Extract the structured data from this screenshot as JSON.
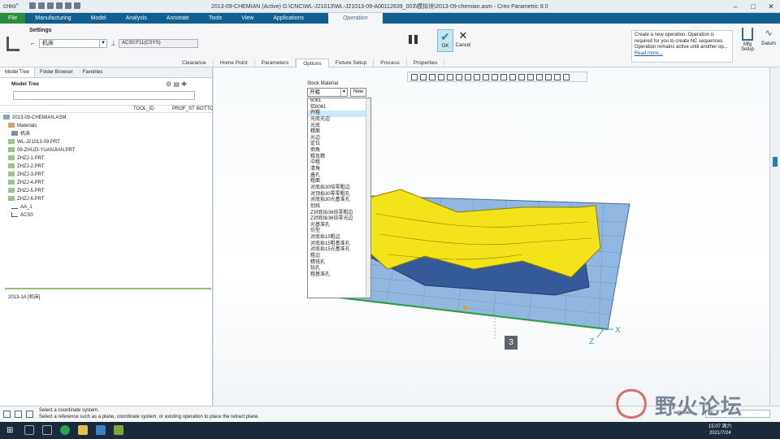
{
  "window": {
    "logo": "creo°",
    "title": "2013-09-CHEMIAN (Active) G:\\CNC\\WL-J21013\\WL-J21013-09-A00112639_003\\模拟块\\2013-09-chemian.asm - Creo Parametric 8.0"
  },
  "ribbon_tabs": [
    "File",
    "Manufacturing",
    "Model",
    "Analysis",
    "Annotate",
    "Tools",
    "View",
    "Applications",
    "Operation"
  ],
  "ribbon": {
    "settings_label": "Settings",
    "machine_value": "机床",
    "csys_value": "ACS0:F11(CSYS)",
    "ok_label": "OK",
    "cancel_label": "Cancel",
    "subtabs": [
      "Clearance",
      "Home Point",
      "Parameters",
      "Options",
      "Fixture Setup",
      "Process",
      "Properties"
    ],
    "message": "Create a new operation. Operation is required for you to create NC sequences. Operation remains active until another op...",
    "read_more": "Read more...",
    "mfg_setup_label": "Mfg Setup",
    "datum_label": "Datum"
  },
  "left_panel": {
    "tabs": [
      "Model Tree",
      "Folder Browser",
      "Favorites"
    ],
    "model_tree_label": "Model Tree",
    "columns": [
      "TOOL_ID",
      "PROF_ST",
      "BOTTC"
    ],
    "tree": [
      "2013-09-CHEMIAN.ASM",
      "Materials",
      "机床",
      "WL-J21013-09.PRT",
      "09-ZHUZI-YUANJIAN.PRT",
      "ZHZJ-1.PRT",
      "ZHZJ-2.PRT",
      "ZHZJ-3.PRT",
      "ZHZJ-4.PRT",
      "ZHZJ-5.PRT",
      "ZHZJ-6.PRT",
      "AA_1",
      "ACS0"
    ],
    "op_node": "2013-1A [机床]"
  },
  "stock_material": {
    "label": "Stock Material",
    "selected": "开粗",
    "new_button": "New",
    "options": [
      "6061",
      "铝6061",
      "开粗",
      "光底光边",
      "光底",
      "精面",
      "光边",
      "定位",
      "倒角",
      "粗及精",
      "中粗",
      "清角",
      "叠孔",
      "粗面",
      "对底抬30倍零粗边",
      "对顶抬30零零粗孔",
      "对底抬30光基准孔",
      "划线",
      "Z对底抬36倍零粗边",
      "Z对底抬36倍零光边",
      "光基准孔",
      "仿型",
      "对底抬15粗边",
      "对底抬15粗基准孔",
      "对底抬15光基准孔",
      "粗边",
      "精铣孔",
      "钻孔",
      "粗基准孔"
    ]
  },
  "viewport": {
    "badge": "3"
  },
  "status_bar": {
    "line1": "Select a coordinate system.",
    "line2": "Select a reference such as a plane, coordinate system, or existing operation to place the retract plane.",
    "selected_count": "1 selected",
    "filter": "All"
  },
  "watermark": {
    "text": "野火论坛"
  },
  "taskbar": {
    "time": "15:07 周六",
    "date": "2021/7/24"
  }
}
